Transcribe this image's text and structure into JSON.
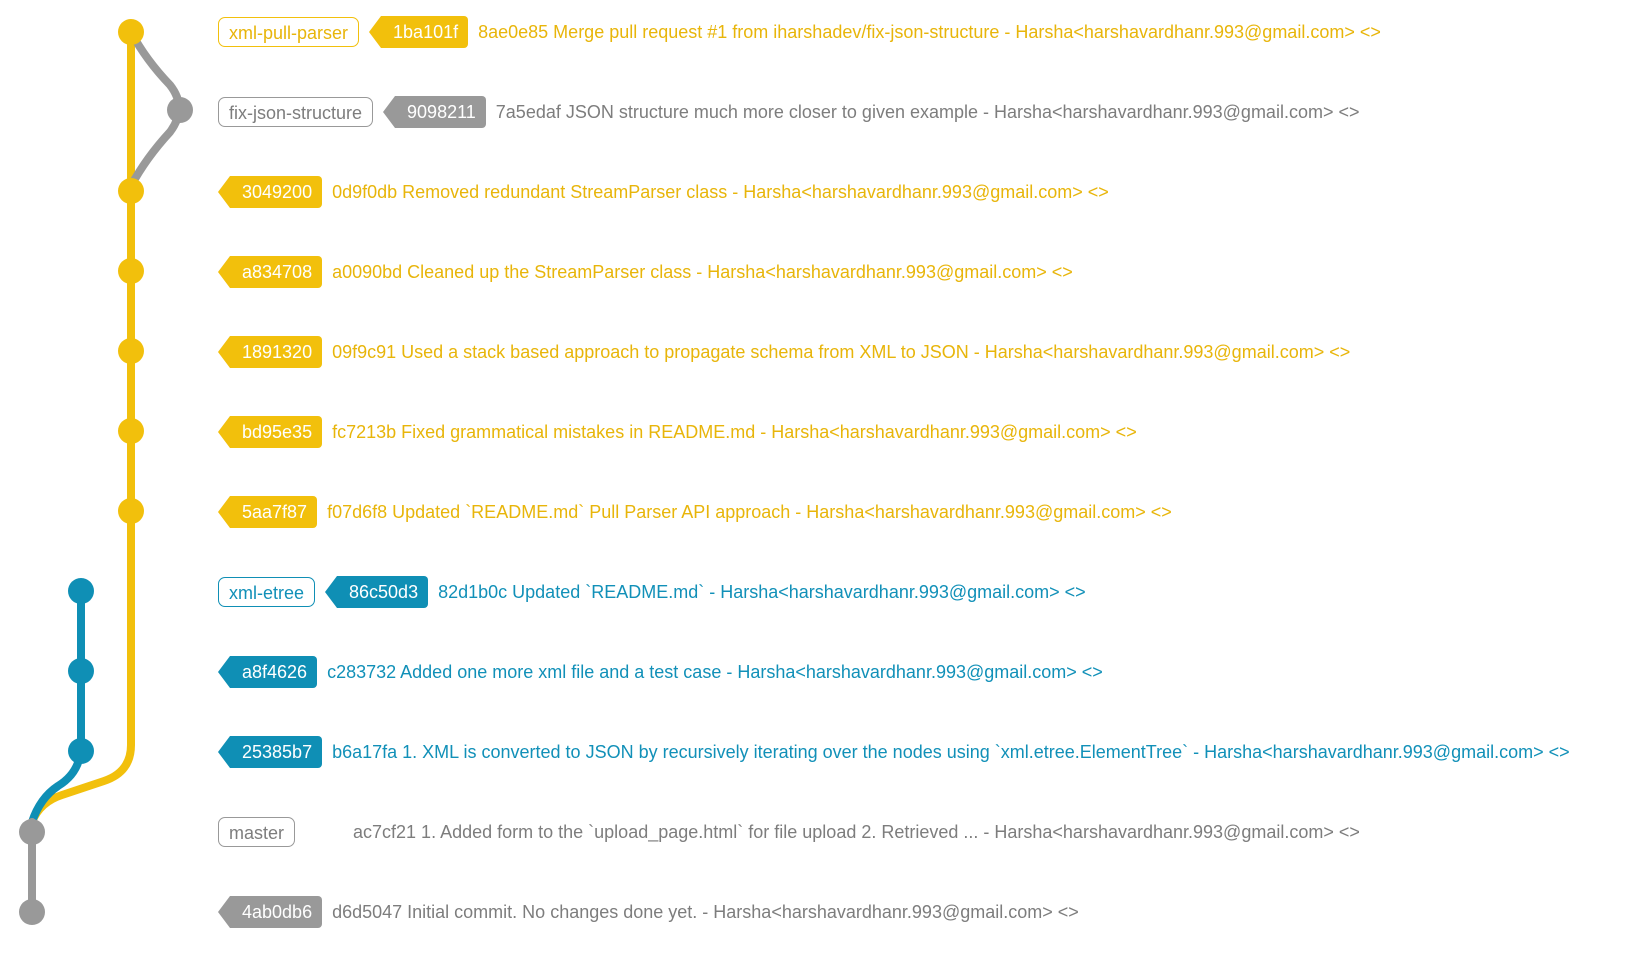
{
  "colors": {
    "yellow": "#f2c00c",
    "yellow_text": "#e8b50a",
    "gray": "#999999",
    "gray_text": "#7d7d7d",
    "blue": "#0f8fb5",
    "blue_text": "#1190b8"
  },
  "commits": [
    {
      "branch_label": "xml-pull-parser",
      "hash": "1ba101f",
      "message": "8ae0e85 Merge pull request #1 from iharshadev/fix-json-structure - Harsha<harshavardhanr.993@gmail.com> <>",
      "color": "yellow"
    },
    {
      "branch_label": "fix-json-structure",
      "hash": "9098211",
      "message": "7a5edaf JSON structure much more closer to given example - Harsha<harshavardhanr.993@gmail.com> <>",
      "color": "gray"
    },
    {
      "branch_label": "",
      "hash": "3049200",
      "message": "0d9f0db Removed redundant StreamParser class - Harsha<harshavardhanr.993@gmail.com> <>",
      "color": "yellow"
    },
    {
      "branch_label": "",
      "hash": "a834708",
      "message": "a0090bd Cleaned up the StreamParser class - Harsha<harshavardhanr.993@gmail.com> <>",
      "color": "yellow"
    },
    {
      "branch_label": "",
      "hash": "1891320",
      "message": "09f9c91 Used a stack based approach to propagate schema from XML to JSON - Harsha<harshavardhanr.993@gmail.com> <>",
      "color": "yellow"
    },
    {
      "branch_label": "",
      "hash": "bd95e35",
      "message": "fc7213b Fixed grammatical mistakes in README.md - Harsha<harshavardhanr.993@gmail.com> <>",
      "color": "yellow"
    },
    {
      "branch_label": "",
      "hash": "5aa7f87",
      "message": "f07d6f8 Updated `README.md` Pull Parser API approach - Harsha<harshavardhanr.993@gmail.com> <>",
      "color": "yellow"
    },
    {
      "branch_label": "xml-etree",
      "hash": "86c50d3",
      "message": "82d1b0c Updated `README.md` - Harsha<harshavardhanr.993@gmail.com> <>",
      "color": "blue"
    },
    {
      "branch_label": "",
      "hash": "a8f4626",
      "message": "c283732 Added one more xml file and a test case - Harsha<harshavardhanr.993@gmail.com> <>",
      "color": "blue"
    },
    {
      "branch_label": "",
      "hash": "25385b7",
      "message": "b6a17fa 1. XML is converted to JSON by recursively iterating over the nodes using `xml.etree.ElementTree` - Harsha<harshavardhanr.993@gmail.com> <>",
      "color": "blue"
    },
    {
      "branch_label": "master",
      "hash": "",
      "message": "ac7cf21 1. Added form to the `upload_page.html` for file upload 2. Retrieved ... - Harsha<harshavardhanr.993@gmail.com> <>",
      "color": "gray"
    },
    {
      "branch_label": "",
      "hash": "4ab0db6",
      "message": "d6d5047 Initial commit. No changes done yet. - Harsha<harshavardhanr.993@gmail.com> <>",
      "color": "gray"
    }
  ]
}
